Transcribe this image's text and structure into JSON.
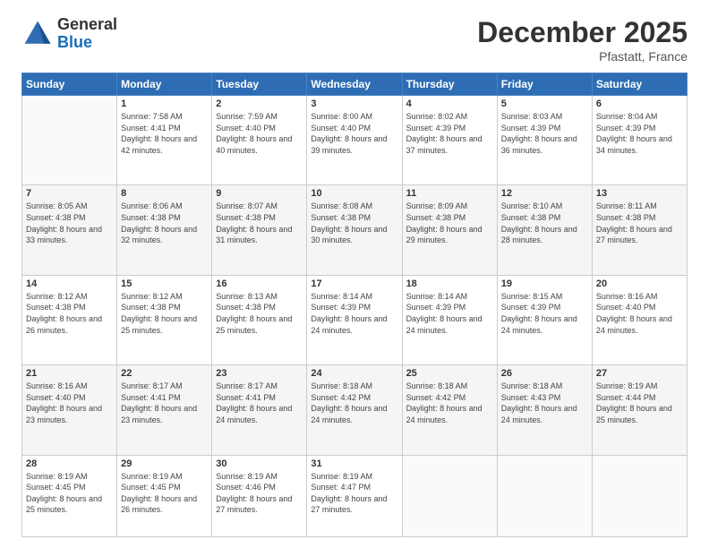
{
  "logo": {
    "general": "General",
    "blue": "Blue"
  },
  "title": "December 2025",
  "location": "Pfastatt, France",
  "days_header": [
    "Sunday",
    "Monday",
    "Tuesday",
    "Wednesday",
    "Thursday",
    "Friday",
    "Saturday"
  ],
  "weeks": [
    [
      {
        "num": "",
        "sunrise": "",
        "sunset": "",
        "daylight": ""
      },
      {
        "num": "1",
        "sunrise": "Sunrise: 7:58 AM",
        "sunset": "Sunset: 4:41 PM",
        "daylight": "Daylight: 8 hours and 42 minutes."
      },
      {
        "num": "2",
        "sunrise": "Sunrise: 7:59 AM",
        "sunset": "Sunset: 4:40 PM",
        "daylight": "Daylight: 8 hours and 40 minutes."
      },
      {
        "num": "3",
        "sunrise": "Sunrise: 8:00 AM",
        "sunset": "Sunset: 4:40 PM",
        "daylight": "Daylight: 8 hours and 39 minutes."
      },
      {
        "num": "4",
        "sunrise": "Sunrise: 8:02 AM",
        "sunset": "Sunset: 4:39 PM",
        "daylight": "Daylight: 8 hours and 37 minutes."
      },
      {
        "num": "5",
        "sunrise": "Sunrise: 8:03 AM",
        "sunset": "Sunset: 4:39 PM",
        "daylight": "Daylight: 8 hours and 36 minutes."
      },
      {
        "num": "6",
        "sunrise": "Sunrise: 8:04 AM",
        "sunset": "Sunset: 4:39 PM",
        "daylight": "Daylight: 8 hours and 34 minutes."
      }
    ],
    [
      {
        "num": "7",
        "sunrise": "Sunrise: 8:05 AM",
        "sunset": "Sunset: 4:38 PM",
        "daylight": "Daylight: 8 hours and 33 minutes."
      },
      {
        "num": "8",
        "sunrise": "Sunrise: 8:06 AM",
        "sunset": "Sunset: 4:38 PM",
        "daylight": "Daylight: 8 hours and 32 minutes."
      },
      {
        "num": "9",
        "sunrise": "Sunrise: 8:07 AM",
        "sunset": "Sunset: 4:38 PM",
        "daylight": "Daylight: 8 hours and 31 minutes."
      },
      {
        "num": "10",
        "sunrise": "Sunrise: 8:08 AM",
        "sunset": "Sunset: 4:38 PM",
        "daylight": "Daylight: 8 hours and 30 minutes."
      },
      {
        "num": "11",
        "sunrise": "Sunrise: 8:09 AM",
        "sunset": "Sunset: 4:38 PM",
        "daylight": "Daylight: 8 hours and 29 minutes."
      },
      {
        "num": "12",
        "sunrise": "Sunrise: 8:10 AM",
        "sunset": "Sunset: 4:38 PM",
        "daylight": "Daylight: 8 hours and 28 minutes."
      },
      {
        "num": "13",
        "sunrise": "Sunrise: 8:11 AM",
        "sunset": "Sunset: 4:38 PM",
        "daylight": "Daylight: 8 hours and 27 minutes."
      }
    ],
    [
      {
        "num": "14",
        "sunrise": "Sunrise: 8:12 AM",
        "sunset": "Sunset: 4:38 PM",
        "daylight": "Daylight: 8 hours and 26 minutes."
      },
      {
        "num": "15",
        "sunrise": "Sunrise: 8:12 AM",
        "sunset": "Sunset: 4:38 PM",
        "daylight": "Daylight: 8 hours and 25 minutes."
      },
      {
        "num": "16",
        "sunrise": "Sunrise: 8:13 AM",
        "sunset": "Sunset: 4:38 PM",
        "daylight": "Daylight: 8 hours and 25 minutes."
      },
      {
        "num": "17",
        "sunrise": "Sunrise: 8:14 AM",
        "sunset": "Sunset: 4:39 PM",
        "daylight": "Daylight: 8 hours and 24 minutes."
      },
      {
        "num": "18",
        "sunrise": "Sunrise: 8:14 AM",
        "sunset": "Sunset: 4:39 PM",
        "daylight": "Daylight: 8 hours and 24 minutes."
      },
      {
        "num": "19",
        "sunrise": "Sunrise: 8:15 AM",
        "sunset": "Sunset: 4:39 PM",
        "daylight": "Daylight: 8 hours and 24 minutes."
      },
      {
        "num": "20",
        "sunrise": "Sunrise: 8:16 AM",
        "sunset": "Sunset: 4:40 PM",
        "daylight": "Daylight: 8 hours and 24 minutes."
      }
    ],
    [
      {
        "num": "21",
        "sunrise": "Sunrise: 8:16 AM",
        "sunset": "Sunset: 4:40 PM",
        "daylight": "Daylight: 8 hours and 23 minutes."
      },
      {
        "num": "22",
        "sunrise": "Sunrise: 8:17 AM",
        "sunset": "Sunset: 4:41 PM",
        "daylight": "Daylight: 8 hours and 23 minutes."
      },
      {
        "num": "23",
        "sunrise": "Sunrise: 8:17 AM",
        "sunset": "Sunset: 4:41 PM",
        "daylight": "Daylight: 8 hours and 24 minutes."
      },
      {
        "num": "24",
        "sunrise": "Sunrise: 8:18 AM",
        "sunset": "Sunset: 4:42 PM",
        "daylight": "Daylight: 8 hours and 24 minutes."
      },
      {
        "num": "25",
        "sunrise": "Sunrise: 8:18 AM",
        "sunset": "Sunset: 4:42 PM",
        "daylight": "Daylight: 8 hours and 24 minutes."
      },
      {
        "num": "26",
        "sunrise": "Sunrise: 8:18 AM",
        "sunset": "Sunset: 4:43 PM",
        "daylight": "Daylight: 8 hours and 24 minutes."
      },
      {
        "num": "27",
        "sunrise": "Sunrise: 8:19 AM",
        "sunset": "Sunset: 4:44 PM",
        "daylight": "Daylight: 8 hours and 25 minutes."
      }
    ],
    [
      {
        "num": "28",
        "sunrise": "Sunrise: 8:19 AM",
        "sunset": "Sunset: 4:45 PM",
        "daylight": "Daylight: 8 hours and 25 minutes."
      },
      {
        "num": "29",
        "sunrise": "Sunrise: 8:19 AM",
        "sunset": "Sunset: 4:45 PM",
        "daylight": "Daylight: 8 hours and 26 minutes."
      },
      {
        "num": "30",
        "sunrise": "Sunrise: 8:19 AM",
        "sunset": "Sunset: 4:46 PM",
        "daylight": "Daylight: 8 hours and 27 minutes."
      },
      {
        "num": "31",
        "sunrise": "Sunrise: 8:19 AM",
        "sunset": "Sunset: 4:47 PM",
        "daylight": "Daylight: 8 hours and 27 minutes."
      },
      {
        "num": "",
        "sunrise": "",
        "sunset": "",
        "daylight": ""
      },
      {
        "num": "",
        "sunrise": "",
        "sunset": "",
        "daylight": ""
      },
      {
        "num": "",
        "sunrise": "",
        "sunset": "",
        "daylight": ""
      }
    ]
  ]
}
